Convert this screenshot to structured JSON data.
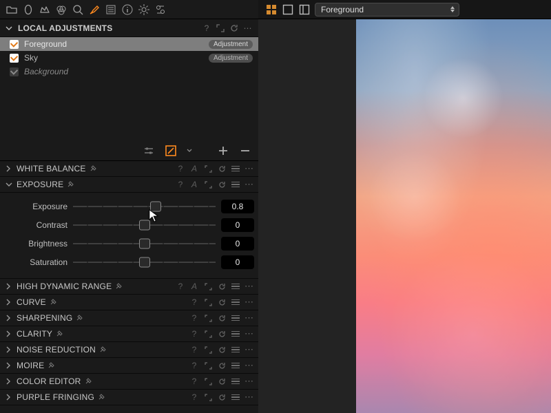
{
  "top_selector": {
    "value": "Foreground"
  },
  "local_adjustments": {
    "title": "LOCAL ADJUSTMENTS",
    "items": [
      {
        "name": "Foreground",
        "badge": "Adjustment",
        "enabled": true,
        "selected": true
      },
      {
        "name": "Sky",
        "badge": "Adjustment",
        "enabled": true,
        "selected": false
      },
      {
        "name": "Background",
        "badge": "",
        "enabled": false,
        "selected": false
      }
    ]
  },
  "exposure": {
    "title": "EXPOSURE",
    "params": [
      {
        "label": "Exposure",
        "value": "0.8",
        "pos": 58
      },
      {
        "label": "Contrast",
        "value": "0",
        "pos": 50
      },
      {
        "label": "Brightness",
        "value": "0",
        "pos": 50
      },
      {
        "label": "Saturation",
        "value": "0",
        "pos": 50
      }
    ]
  },
  "tools": [
    {
      "title": "WHITE BALANCE",
      "hasA": true
    },
    {
      "title": "HIGH DYNAMIC RANGE",
      "hasA": true
    },
    {
      "title": "CURVE",
      "hasA": false
    },
    {
      "title": "SHARPENING",
      "hasA": false
    },
    {
      "title": "CLARITY",
      "hasA": false
    },
    {
      "title": "NOISE REDUCTION",
      "hasA": false
    },
    {
      "title": "MOIRE",
      "hasA": false
    },
    {
      "title": "COLOR EDITOR",
      "hasA": false
    },
    {
      "title": "PURPLE FRINGING",
      "hasA": false
    }
  ]
}
